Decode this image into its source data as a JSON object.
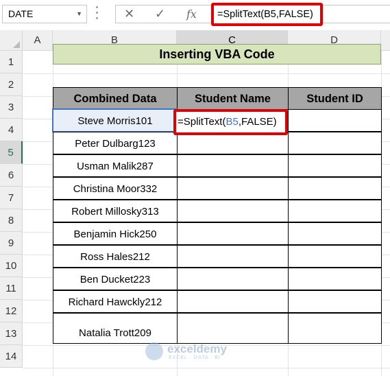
{
  "name_box": {
    "value": "DATE"
  },
  "formula_bar": {
    "cancel_icon": "✕",
    "enter_icon": "✓",
    "fx_label": "fx",
    "formula": "=SplitText(B5,FALSE)"
  },
  "columns": [
    "A",
    "B",
    "C",
    "D"
  ],
  "rows": [
    "1",
    "2",
    "3",
    "4",
    "5",
    "6",
    "7",
    "8",
    "9",
    "10",
    "11",
    "12",
    "13",
    "14"
  ],
  "banner": {
    "title": "Inserting VBA Code"
  },
  "table": {
    "headers": [
      "Combined Data",
      "Student Name",
      "Student ID"
    ],
    "combined_data": [
      "Steve Morris101",
      "Peter Dulbarg123",
      "Usman Malik287",
      "Christina Moor332",
      "Robert Millosky313",
      "Benjamin Hick250",
      "Ross Hales212",
      "Ben Ducket223",
      "Richard Hawckly212",
      "Natalia Trott209"
    ]
  },
  "active_cell": {
    "formula_prefix": "=SplitText(",
    "formula_ref": "B5",
    "formula_suffix": ",FALSE)"
  },
  "colors": {
    "accent_green": "#217346",
    "banner_fill": "#d8e4bc",
    "header_fill": "#a6a6a6",
    "highlight_red": "#e00000"
  },
  "watermark": {
    "name": "exceldemy",
    "tagline": "EXCEL · DATA · BI"
  }
}
